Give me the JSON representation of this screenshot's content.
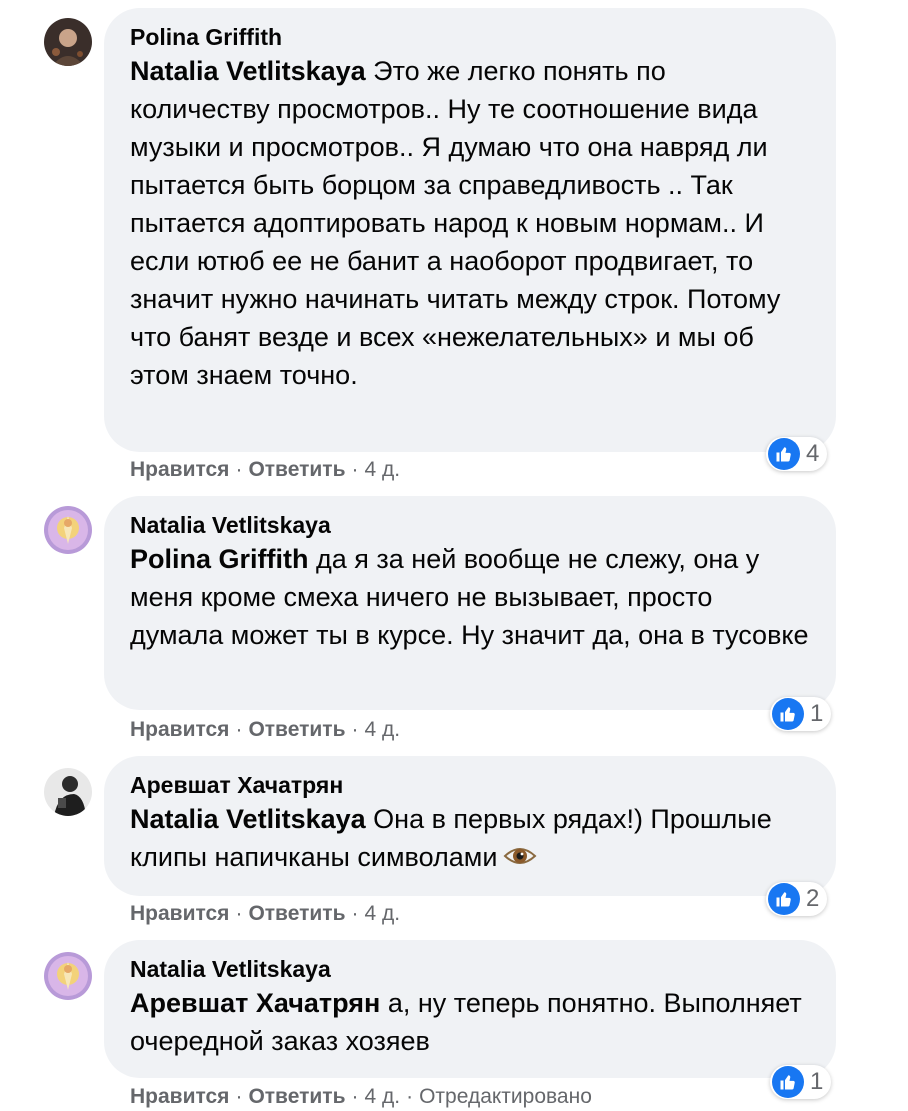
{
  "labels": {
    "like": "Нравится",
    "reply": "Ответить",
    "separator": "·",
    "edited": "Отредактировано"
  },
  "colors": {
    "bubble_bg": "#f0f2f5",
    "like_blue": "#1877f2",
    "meta_gray": "#65676b"
  },
  "comments": [
    {
      "author": "Polina Griffith",
      "mention": "Natalia Vetlitskaya",
      "text": " Это же легко понять по количеству просмотров.. Ну те соотношение вида музыки и просмотров.. Я думаю что она навряд ли пытается быть борцом за справедливость .. Так пытается адоптировать народ к новым нормам.. И если ютюб ее не банит а наоборот продвигает, то значит нужно начинать читать между строк. Потому что банят везде и всех «нежелательных» и мы об этом знаем точно.",
      "time": "4 д.",
      "reactions": "4",
      "reaction_icon": "like-icon"
    },
    {
      "author": "Natalia Vetlitskaya",
      "mention": "Polina Griffith",
      "text": " да я за ней вообще не слежу, она у меня кроме смеха ничего не вызывает, просто думала может ты в курсе. Ну значит да, она в тусовке",
      "time": "4 д.",
      "reactions": "1",
      "reaction_icon": "like-icon"
    },
    {
      "author": "Аревшат Хачатрян",
      "mention": "Natalia Vetlitskaya",
      "text": " Она в первых рядах!) Прошлые клипы напичканы символами",
      "emoji": "eye-emoji",
      "time": "4 д.",
      "reactions": "2",
      "reaction_icon": "like-icon"
    },
    {
      "author": "Natalia Vetlitskaya",
      "mention": "Аревшат Хачатрян",
      "text": " а, ну теперь понятно. Выполняет очередной заказ хозяев",
      "time": "4 д.",
      "reactions": "1",
      "reaction_icon": "like-icon",
      "edited": true
    }
  ]
}
